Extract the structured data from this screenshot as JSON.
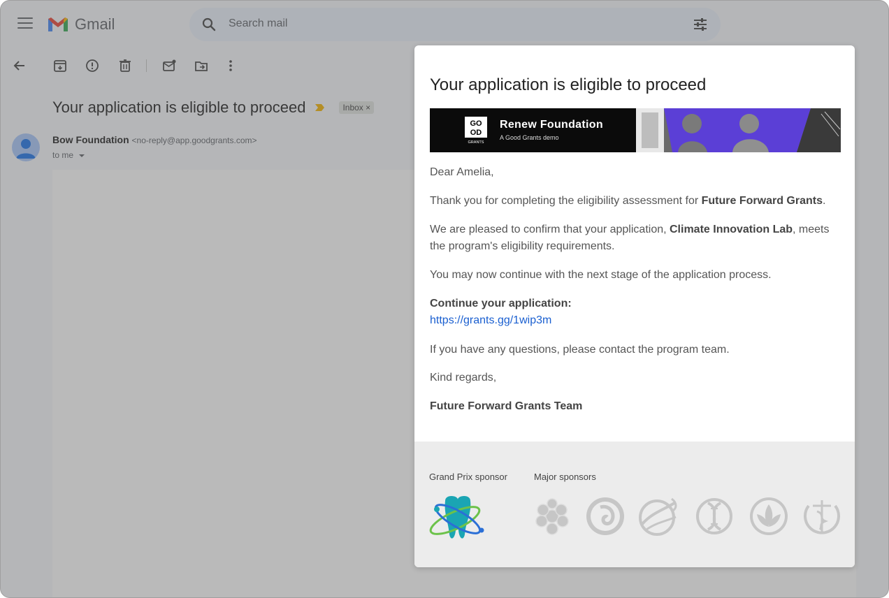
{
  "gmail": {
    "app_name": "Gmail",
    "search_placeholder": "Search mail",
    "subject": "Your application is eligible to proceed",
    "label_chip": "Inbox ×",
    "sender_name": "Bow Foundation",
    "sender_email": "<no-reply@app.goodgrants.com>",
    "to_line": "to me",
    "colors": {
      "background": "#f6f8fc",
      "search": "#eaf1fb",
      "importance": "#f4b400"
    }
  },
  "email": {
    "title": "Your application is eligible to proceed",
    "banner": {
      "logo_letters": [
        "GO",
        "OD"
      ],
      "logo_sub": "GRANTS",
      "name": "Renew Foundation",
      "tagline": "A Good Grants demo"
    },
    "greeting": "Dear Amelia,",
    "thanks_prefix": "Thank you for completing the eligibility assessment for ",
    "program_name": "Future Forward Grants",
    "thanks_suffix": ".",
    "confirm_prefix": "We are pleased to confirm that your application, ",
    "application_name": "Climate Innovation Lab",
    "confirm_suffix": ", meets the program's eligibility requirements.",
    "next_stage": "You may now continue with the next stage of the application process.",
    "continue_heading": "Continue your application:",
    "continue_link": "https://grants.gg/1wip3m",
    "questions": "If you have any questions, please contact the program team.",
    "regards": "Kind regards,",
    "signature": "Future Forward Grants Team",
    "footer": {
      "grand_prix_label": "Grand Prix sponsor",
      "major_label": "Major sponsors",
      "sponsor_icons": [
        "cell-cluster-icon",
        "fetus-icon",
        "leaf-swirl-icon",
        "dna-icon",
        "lotus-icon",
        "caduceus-icon"
      ]
    },
    "colors": {
      "banner_bg": "#0b0b0b",
      "banner_accent": "#5b3fd6",
      "link": "#1a5fd0",
      "footer_bg": "#ececec"
    }
  }
}
